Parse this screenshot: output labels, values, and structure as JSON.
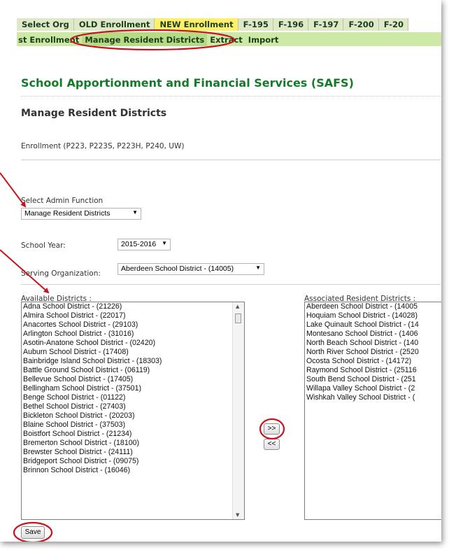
{
  "nav_tabs": [
    "Select Org",
    "OLD Enrollment",
    "NEW Enrollment",
    "F-195",
    "F-196",
    "F-197",
    "F-200",
    "F-20"
  ],
  "sub_tabs": [
    "st Enrollment",
    "Manage Resident Districts",
    "Extract",
    "Import"
  ],
  "page_title": "School Apportionment and Financial Services (SAFS)",
  "section_title": "Manage Resident Districts",
  "enrollment_text": "Enrollment (P223, P223S, P223H, P240, UW)",
  "admin_function": {
    "label": "Select Admin Function",
    "value": "Manage Resident Districts"
  },
  "school_year": {
    "label": "School Year:",
    "value": "2015-2016"
  },
  "serving_org": {
    "label": "Serving Organization:",
    "value": "Aberdeen School District - (14005)"
  },
  "available": {
    "label": "Available Districts :",
    "items": [
      "Adna School District - (21226)",
      "Almira School District - (22017)",
      "Anacortes School District - (29103)",
      "Arlington School District - (31016)",
      "Asotin-Anatone School District - (02420)",
      "Auburn School District - (17408)",
      "Bainbridge Island School District - (18303)",
      "Battle Ground School District - (06119)",
      "Bellevue School District - (17405)",
      "Bellingham School District - (37501)",
      "Benge School District - (01122)",
      "Bethel School District - (27403)",
      "Bickleton School District - (20203)",
      "Blaine School District - (37503)",
      "Boistfort School District - (21234)",
      "Bremerton School District - (18100)",
      "Brewster School District - (24111)",
      "Bridgeport School District - (09075)",
      "Brinnon School District - (16046)"
    ]
  },
  "associated": {
    "label": "Associated Resident Districts :",
    "items": [
      "Aberdeen School District - (14005",
      "Hoquiam School District - (14028)",
      "Lake Quinault School District - (14",
      "Montesano School District - (1406",
      "North Beach School District - (140",
      "North River School District - (2520",
      "Ocosta School District - (14172)",
      "Raymond School District - (25116",
      "South Bend School District - (251",
      "Willapa Valley School District - (2",
      "Wishkah Valley School District - ("
    ]
  },
  "buttons": {
    "add": ">>",
    "remove": "<<",
    "save": "Save"
  },
  "colors": {
    "active_tab": "#ffef6b",
    "tab_bar": "#dfe9c9",
    "subtab_bar": "#cde9a6",
    "title_green": "#157a2a",
    "annotation_red": "#c8141e"
  }
}
